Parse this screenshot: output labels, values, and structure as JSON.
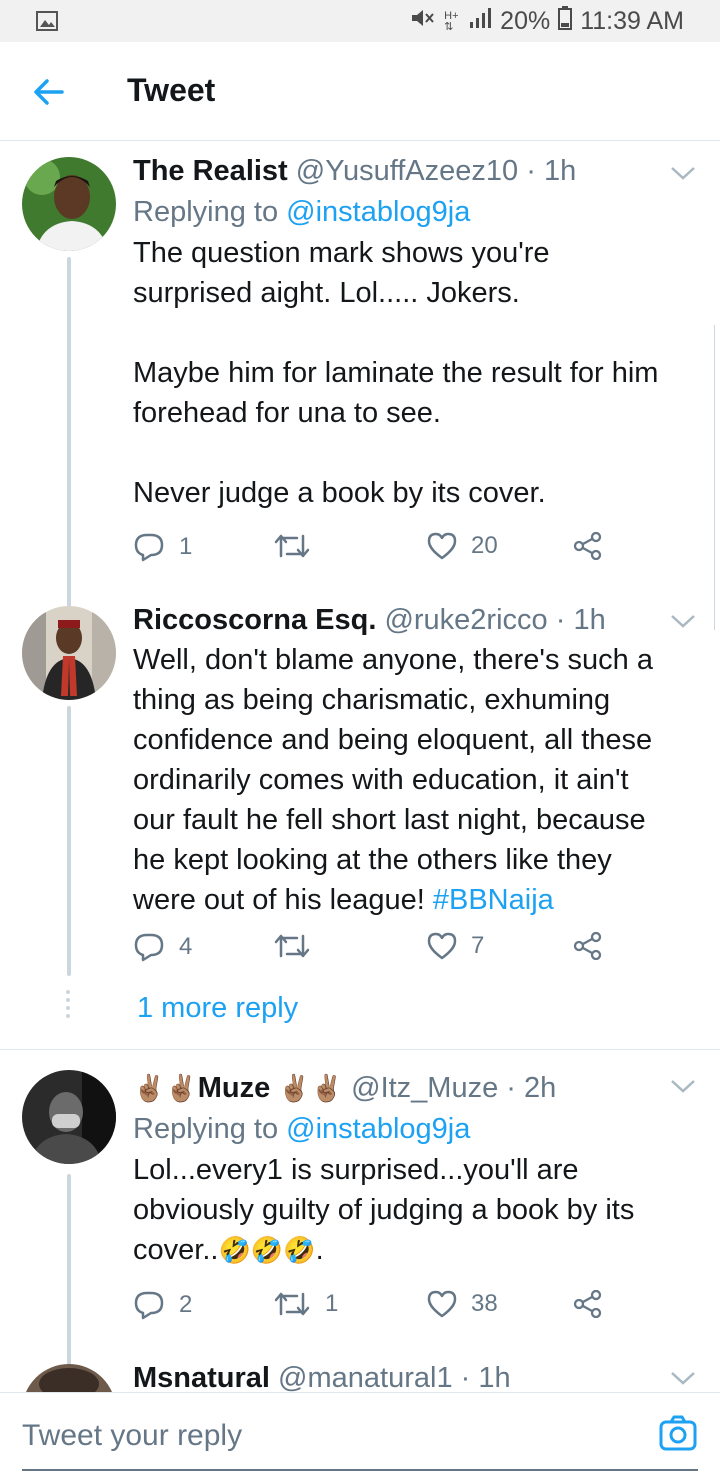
{
  "status": {
    "signal": "20%",
    "time": "11:39 AM"
  },
  "appbar": {
    "title": "Tweet"
  },
  "tweets": [
    {
      "name": "The Realist",
      "handle": "@YusuffAzeez10",
      "sep": " · ",
      "time": "1h",
      "replying_prefix": "Replying to ",
      "replying_to": "@instablog9ja",
      "text": "The question mark shows you're\nsurprised aight. Lol..... Jokers.\n\nMaybe him for laminate the result for him\nforehead for una to see.\n\nNever judge a book by its cover.",
      "replies": "1",
      "retweets": "",
      "likes": "20"
    },
    {
      "name": "Riccoscorna Esq.",
      "handle": "@ruke2ricco",
      "sep": " · ",
      "time": "1h",
      "text": "Well, don't blame anyone, there's such a\nthing as being charismatic, exhuming\nconfidence and being eloquent, all these\nordinarily comes with education, it ain't\nour fault he fell short last night, because\nhe kept looking at the others like they\nwere out of his league! ",
      "hashtag": "#BBNaija",
      "replies": "4",
      "retweets": "",
      "likes": "7",
      "more_replies": "1 more reply"
    },
    {
      "name_prefix": "✌🏽✌🏽",
      "name": "Muze",
      "name_suffix": "✌🏽✌🏽",
      "handle": "@Itz_Muze",
      "sep": " · ",
      "time": "2h",
      "replying_prefix": "Replying to ",
      "replying_to": "@instablog9ja",
      "text": "Lol...every1 is surprised...you'll are\nobviously guilty of judging a book by its\ncover..",
      "text_emoji": "🤣🤣🤣",
      "text_end": ".",
      "replies": "2",
      "retweets": "1",
      "likes": "38"
    },
    {
      "name": "Msnatural",
      "handle": "@manatural1",
      "sep": " · ",
      "time": "1h"
    }
  ],
  "composer": {
    "placeholder": "Tweet your reply"
  },
  "colors": {
    "link": "#1da1f2",
    "muted": "#657786",
    "text": "#14171a",
    "divider": "#e1e8ed"
  }
}
